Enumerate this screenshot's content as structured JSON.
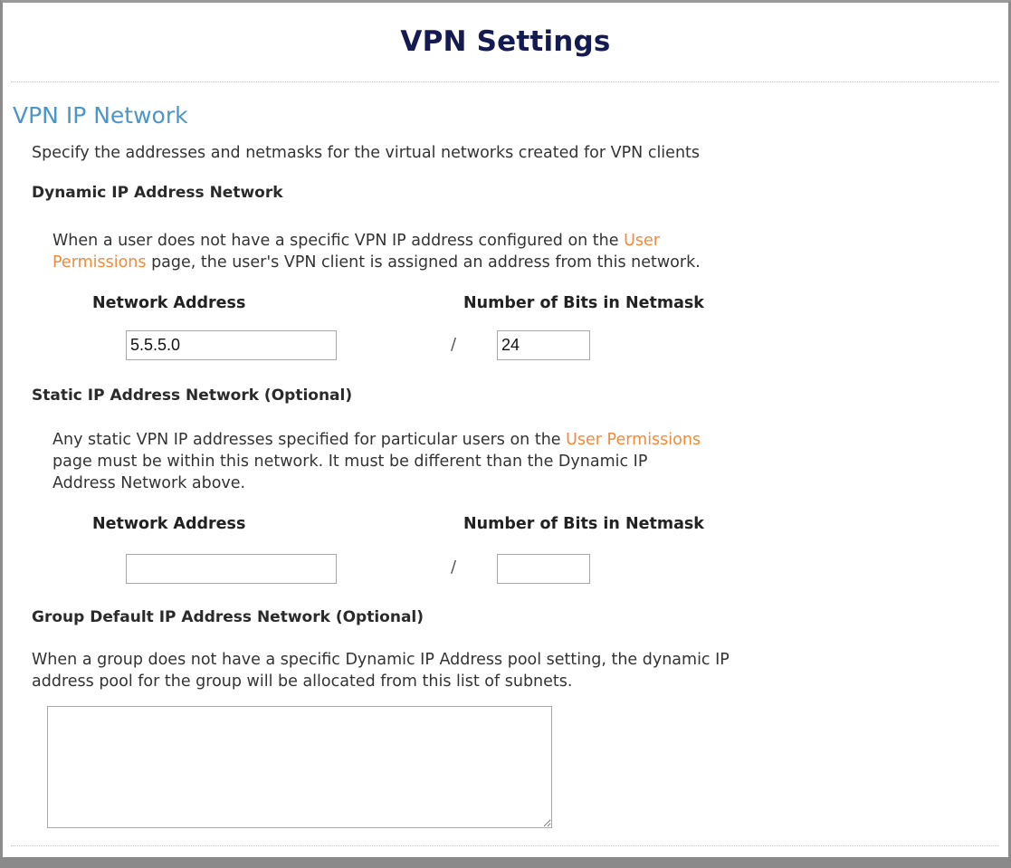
{
  "page": {
    "title": "VPN Settings"
  },
  "section": {
    "title": "VPN IP Network",
    "intro": "Specify the addresses and netmasks for the virtual networks created for VPN clients"
  },
  "dynamic": {
    "heading": "Dynamic IP Address Network",
    "desc_line1_prefix": "When a user does not have a specific VPN IP address configured on the ",
    "desc_link_part1": "User",
    "desc_link_part2": "Permissions",
    "desc_line2_suffix": " page, the user's VPN client is assigned an address from this network.",
    "network_address_label": "Network Address",
    "netmask_bits_label": "Number of Bits in Netmask",
    "network_address_value": "5.5.5.0",
    "separator": "/",
    "netmask_bits_value": "24"
  },
  "static": {
    "heading": "Static IP Address Network (Optional)",
    "desc_prefix": "Any static VPN IP addresses specified for particular users on the ",
    "desc_link": "User Permissions",
    "desc_line2": "page must be within this network. It must be different than the Dynamic IP",
    "desc_line3": "Address Network above.",
    "network_address_label": "Network Address",
    "netmask_bits_label": "Number of Bits in Netmask",
    "network_address_value": "",
    "separator": "/",
    "netmask_bits_value": ""
  },
  "group": {
    "heading": "Group Default IP Address Network (Optional)",
    "desc_line1": "When a group does not have a specific Dynamic IP Address pool setting, the dynamic IP",
    "desc_line2": "address pool for the group will be allocated from this list of subnets.",
    "subnets_value": ""
  }
}
